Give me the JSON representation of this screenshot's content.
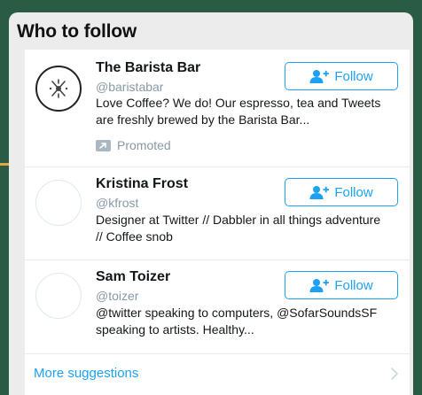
{
  "widget": {
    "title": "Who to follow",
    "more_label": "More suggestions"
  },
  "accounts": [
    {
      "name": "The Barista Bar",
      "handle": "@baristabar",
      "bio": "Love Coffee? We do! Our espresso, tea and Tweets are freshly brewed by the Barista Bar...",
      "follow_label": "Follow",
      "promoted_label": "Promoted",
      "avatar_icon": "barista-logo-icon"
    },
    {
      "name": "Kristina Frost",
      "handle": "@kfrost",
      "bio": "Designer at Twitter // Dabbler in all things adventure // Coffee snob",
      "follow_label": "Follow",
      "avatar_icon": "blank-avatar"
    },
    {
      "name": "Sam Toizer",
      "handle": "@toizer",
      "bio": "@twitter speaking to computers, @SofarSoundsSF speaking to artists. Healthy...",
      "follow_label": "Follow",
      "avatar_icon": "blank-avatar"
    }
  ],
  "colors": {
    "background": "#2a5c45",
    "card": "#ececec",
    "accent": "#1da1f2",
    "muted": "#8899a6",
    "connector": "#e3a63a"
  },
  "icons": {
    "follow": "add-user-icon",
    "promoted": "promoted-arrow-icon",
    "more": "chevron-right-icon"
  }
}
